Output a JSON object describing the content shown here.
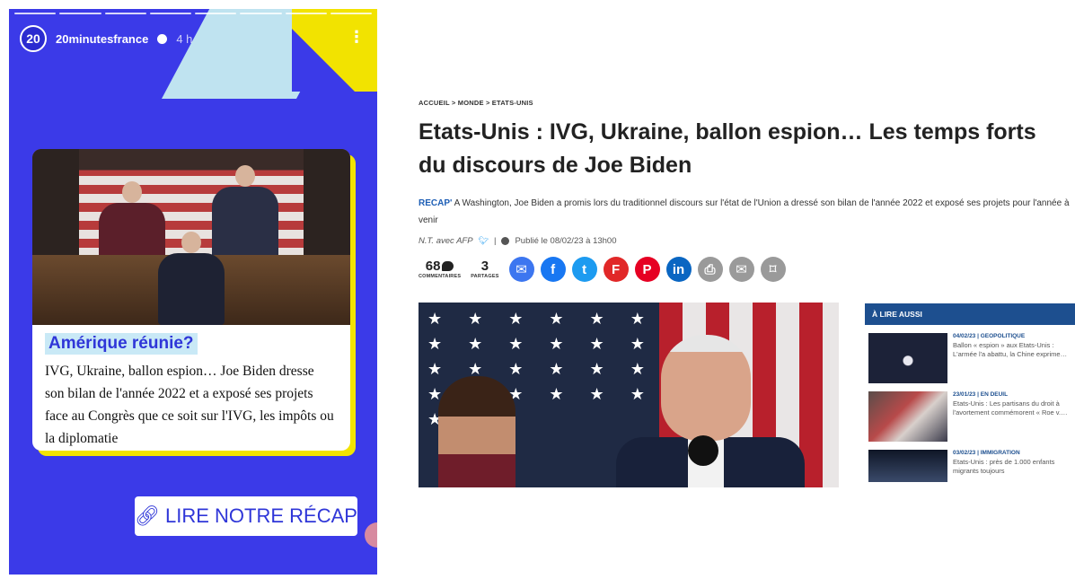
{
  "story": {
    "username": "20minutesfrance",
    "time": "4 h",
    "avatar_text": "20",
    "more_icon": "⋮",
    "kicker": "Amérique réunie?",
    "text": "IVG, Ukraine, ballon espion… Joe Biden dresse son bilan de l'année 2022 et a exposé ses projets face au Congrès que ce soit sur l'IVG, les impôts ou la diplomatie",
    "cta_label": "LIRE NOTRE RÉCAP",
    "cta_icon": "link-icon",
    "colors": {
      "background": "#3b3ae8",
      "accent_yellow": "#f2e300",
      "accent_cyan": "#bfe3f0",
      "cta_text": "#2f36d8"
    }
  },
  "article": {
    "breadcrumb": "ACCUEIL > MONDE > ETATS-UNIS",
    "title": "Etats-Unis : IVG, Ukraine, ballon espion… Les temps forts du discours de Joe Biden",
    "chapo_label": "RECAP'",
    "chapo_text": " A Washington, Joe Biden a promis lors du traditionnel discours sur l'état de l'Union a dressé son bilan de l'année 2022 et exposé ses projets pour l'année à venir",
    "author": "N.T. avec AFP",
    "separator": "|",
    "published": "Publié le 08/02/23 à 13h00",
    "comments": {
      "count": "68",
      "label": "COMMENTAIRES"
    },
    "shares": {
      "count": "3",
      "label": "PARTAGES"
    },
    "share_buttons": [
      {
        "name": "messenger",
        "glyph": "✉",
        "color": "#3c76f0"
      },
      {
        "name": "facebook",
        "glyph": "f",
        "color": "#1877f2"
      },
      {
        "name": "twitter",
        "glyph": "t",
        "color": "#1d9bf0"
      },
      {
        "name": "flipboard",
        "glyph": "F",
        "color": "#e12828"
      },
      {
        "name": "pinterest",
        "glyph": "P",
        "color": "#e60023"
      },
      {
        "name": "linkedin",
        "glyph": "in",
        "color": "#0a66c2"
      },
      {
        "name": "print",
        "glyph": "⎙",
        "color": "#9a9a9a"
      },
      {
        "name": "email",
        "glyph": "✉",
        "color": "#9a9a9a"
      },
      {
        "name": "bookmark",
        "glyph": "⌑",
        "color": "#9a9a9a"
      }
    ],
    "aside": {
      "title": "À LIRE AUSSI",
      "items": [
        {
          "category": "04/02/23 | GEOPOLITIQUE",
          "text": "Ballon « espion » aux Etats-Unis : L'armée l'a abattu, la Chine exprime…"
        },
        {
          "category": "23/01/23 | EN DEUIL",
          "text": "Etats-Unis : Les partisans du droit à l'avortement commémorent « Roe v.…"
        },
        {
          "category": "03/02/23 | IMMIGRATION",
          "text": "Etats-Unis : près de 1.000 enfants migrants toujours"
        }
      ]
    }
  }
}
